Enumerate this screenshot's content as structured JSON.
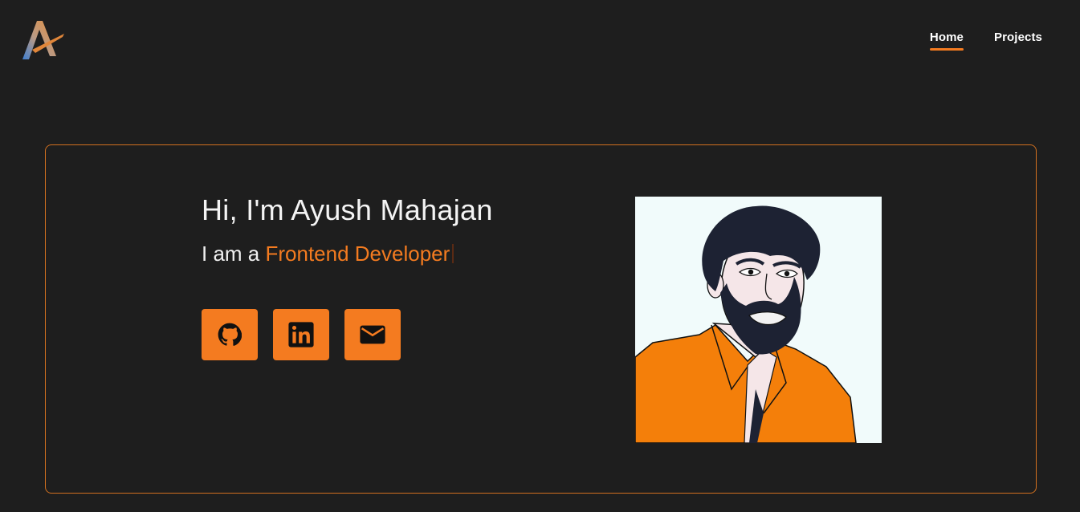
{
  "header": {
    "logo_icon": "stylized-a-logo-icon",
    "nav": {
      "home_label": "Home",
      "projects_label": "Projects",
      "active": "Home"
    }
  },
  "hero": {
    "greeting": "Hi, I'm Ayush Mahajan",
    "role_prefix": "I am a",
    "role": "Frontend Developer",
    "socials": [
      {
        "name": "github",
        "icon": "github-icon"
      },
      {
        "name": "linkedin",
        "icon": "linkedin-icon"
      },
      {
        "name": "email",
        "icon": "mail-icon"
      }
    ],
    "avatar_icon": "portrait-illustration"
  },
  "colors": {
    "background": "#1e1e1e",
    "accent": "#f47b20",
    "border": "#d2701f",
    "text": "#f2f2f2",
    "avatar_bg": "#f1fbfb"
  }
}
